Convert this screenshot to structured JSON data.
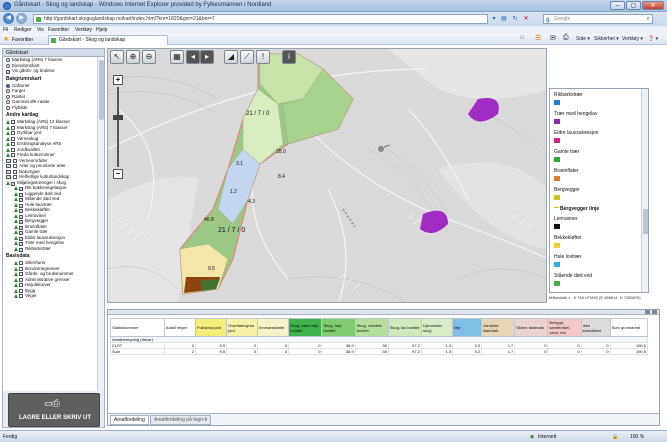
{
  "window": {
    "title": "Gårdskart - Skog og landskap - Windows Internet Explorer provided by Fylkesmannen i Nordland",
    "min": "–",
    "max": "▢",
    "close": "✕"
  },
  "address": {
    "url": "http://gardskart.skogoglandskap.no/kart/index.html?knr=1820&gnr=21&bnr=7",
    "search_placeholder": "Google"
  },
  "menu": [
    "Fil",
    "Rediger",
    "Vis",
    "Favoritter",
    "Verktøy",
    "Hjelp"
  ],
  "favbar": {
    "favorites": "Favoritter",
    "tab": "Gårdskart - Skog og landskap",
    "tools": [
      "Side ▾",
      "Sikkerhet ▾",
      "Verktøy ▾",
      "❓ ▾"
    ]
  },
  "sidebar": {
    "title": "Gårdskart",
    "top_items": [
      "Markslag (AR5) 7 klasser",
      "Eiendomskart",
      "Vis gårds- og bruksnr"
    ],
    "bakgrunn_title": "Bakgrunnskart",
    "bakgrunn_items": [
      "Gråtoner",
      "Farger",
      "Raster",
      "Gammel ØK-raster",
      "Flybilde"
    ],
    "andre_title": "Andre kartlag",
    "andre_items": [
      "Markslag (AR5) 13 klasser",
      "Markslag (AR5) 7 klasser",
      "Dyrkbar jord",
      "Verneskog",
      "Erstningsanalyse AR5",
      "Jordkvalitet",
      "Freda kulturminner",
      "Verneområder",
      "Arter og prioriterte arter",
      "Naturtyper",
      "Helhetlige kulturlandskap",
      "Miljøregistreringer i skog"
    ],
    "miljo_items": [
      "Rik bakkevegetasjon",
      "Liggende død ved",
      "Stående død ved",
      "Hule lauvtrær",
      "Bekkekløfter",
      "Leirraviner",
      "Bergvegger",
      "Brannflater",
      "Gamle trær",
      "Eldre lauvsuksesjon",
      "Trær med hengelav",
      "Rikbarkstrær"
    ],
    "basis_title": "Basisdata",
    "basis_items": [
      "Stiler/turer",
      "Bondomegrenser",
      "Gårds- og bruksnummer",
      "Administrative grenser",
      "Høydekurver",
      "Bygg",
      "Veger"
    ],
    "print_label": "LAGRE ELLER SKRIV UT"
  },
  "map": {
    "parcel_labels": [
      "21 / 7 / 0",
      "21 / 7 / 0",
      "28.0",
      "8.4",
      "46.8",
      "9.5",
      "3.1",
      "4.3",
      "1.2"
    ]
  },
  "legend": {
    "title_bold": "Bergvegger linje",
    "items": [
      {
        "label": "Rikbarkstrær",
        "color": "#1e7fd6"
      },
      {
        "label": "Trær med hengelav",
        "color": "#8a2bb8"
      },
      {
        "label": "Eldre lauvsuksesjon",
        "color": "#d61e86"
      },
      {
        "label": "Gamle trær",
        "color": "#2aa63a"
      },
      {
        "label": "Brannflater",
        "color": "#e37b1f"
      },
      {
        "label": "Bergvegger",
        "color": "#c8c81e"
      },
      {
        "label": "Leirraviner",
        "color": "#111111"
      },
      {
        "label": "Bekkekløfter",
        "color": "#e8d22a"
      },
      {
        "label": "Hule lovtrær",
        "color": "#2ab0d6"
      },
      {
        "label": "Stående død ved",
        "color": "#3db24a"
      }
    ]
  },
  "scale": "Målestokk 1 : 5 748   UTM33 (E 489614, N 7285875)",
  "table": {
    "headers": [
      "Statiskkummer",
      "Antall teiger",
      "Fulldyrka jord",
      "Overflatedyrka jord",
      "Innmarksbeite",
      "Skog, særs høy bonitet",
      "Skog, høy bonitet",
      "Skog, middels bonitet",
      "Skog, lav bonitet",
      "Uproduktiv skog",
      "Myr",
      "Jorddekt fastmark",
      "Skrinn fastmark",
      "Bebygd, samferdsel, vann, bre",
      "Ikke klassifisert",
      "Sum grunnareal"
    ],
    "section": "Arealberegning (dekar)",
    "rows": [
      [
        "21/07",
        "2",
        "9.5",
        "0",
        "0",
        "0",
        "38.9",
        "36",
        "97.2",
        "1.3",
        "3.2",
        "1.7",
        "0",
        "0",
        "0",
        "190.5"
      ],
      [
        "Sum",
        "2",
        "9.5",
        "0",
        "0",
        "0",
        "38.9",
        "36",
        "97.2",
        "1.3",
        "3.2",
        "1.7",
        "0",
        "0",
        "0",
        "190.5"
      ]
    ],
    "header_colors": [
      "#ffffff",
      "#ffffff",
      "#f3ee7a",
      "#f7f3a6",
      "#f6f4c6",
      "#3fb24b",
      "#7fcc6f",
      "#b6df9e",
      "#cfe9bd",
      "#d9ecc8",
      "#7fbfe6",
      "#e6d6b3",
      "#ead2d2",
      "#f2c9c9",
      "#dcdcdc",
      "#ffffff"
    ]
  },
  "bottom_tabs": [
    "Arealfordeling",
    "Arealfordeling på tegn-b"
  ],
  "status": {
    "left": "Ferdig",
    "zone": "Internett",
    "zoom": "100 %"
  }
}
